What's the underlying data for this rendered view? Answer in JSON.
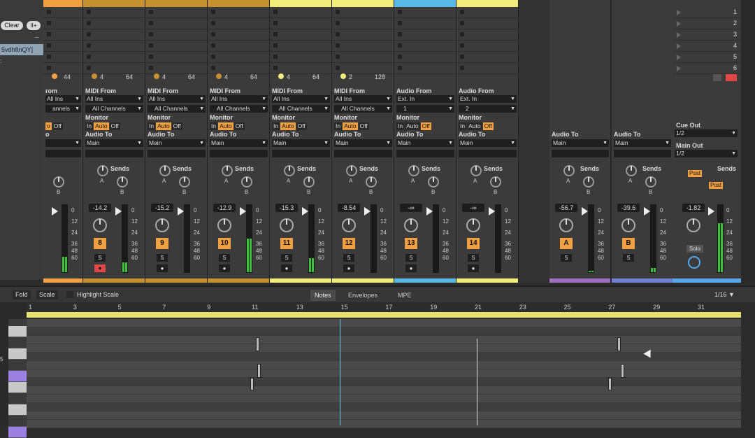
{
  "left": {
    "clear_label": "Clear",
    "more_label": "II+",
    "clip_id": "5vdh8nQY]",
    "minus": "–",
    "dot": ":"
  },
  "tracks": [
    {
      "sub": "4",
      "stop_count": "4",
      "from_label": "rom",
      "from_value": "All Ins",
      "ch": "annels",
      "mon": [
        "o",
        "Off"
      ],
      "mon_on": 0,
      "audio_to": "o",
      "audio_to_val": "",
      "vol": "",
      "num": "",
      "solo": "",
      "arm": "",
      "color": "#f0a040",
      "sends": "",
      "knob_a": "",
      "knob_b": "B",
      "scale": [
        "0",
        "12",
        "24",
        "36",
        "48",
        "60"
      ]
    },
    {
      "sub": "4",
      "stop_count": "64",
      "from_label": "MIDI From",
      "from_value": "All Ins",
      "ch": "All Channels",
      "mon": [
        "In",
        "Auto",
        "Off"
      ],
      "mon_on": 1,
      "audio_to": "Audio To",
      "audio_to_val": "Main",
      "vol": "-14.2",
      "num": "8",
      "solo": "S",
      "arm": "⏺",
      "armred": true,
      "color": "#c49030",
      "sends": "Sends",
      "knob_a": "A",
      "knob_b": "B",
      "scale": [
        "0",
        "12",
        "24",
        "36",
        "48",
        "60"
      ]
    },
    {
      "sub": "4",
      "stop_count": "64",
      "from_label": "MIDI From",
      "from_value": "All Ins",
      "ch": "All Channels",
      "mon": [
        "In",
        "Auto",
        "Off"
      ],
      "mon_on": 1,
      "audio_to": "Audio To",
      "audio_to_val": "Main",
      "vol": "-15.2",
      "num": "9",
      "solo": "S",
      "arm": "●",
      "armred": false,
      "color": "#c49030",
      "sends": "Sends",
      "knob_a": "A",
      "knob_b": "B",
      "scale": [
        "0",
        "12",
        "24",
        "36",
        "48",
        "60"
      ]
    },
    {
      "sub": "4",
      "stop_count": "64",
      "from_label": "MIDI From",
      "from_value": "All Ins",
      "ch": "All Channels",
      "mon": [
        "In",
        "Auto",
        "Off"
      ],
      "mon_on": 1,
      "audio_to": "Audio To",
      "audio_to_val": "Main",
      "vol": "-12.9",
      "num": "10",
      "solo": "S",
      "arm": "●",
      "armred": false,
      "color": "#c49030",
      "sends": "Sends",
      "knob_a": "A",
      "knob_b": "B",
      "scale": [
        "0",
        "12",
        "24",
        "36",
        "48",
        "60"
      ]
    },
    {
      "sub": "4",
      "stop_count": "64",
      "from_label": "MIDI From",
      "from_value": "All Ins",
      "ch": "All Channels",
      "mon": [
        "In",
        "Auto",
        "Off"
      ],
      "mon_on": 1,
      "audio_to": "Audio To",
      "audio_to_val": "Main",
      "vol": "-15.3",
      "num": "11",
      "solo": "S",
      "arm": "●",
      "armred": false,
      "color": "#f2ec7a",
      "sends": "Sends",
      "knob_a": "A",
      "knob_b": "B",
      "scale": [
        "0",
        "12",
        "24",
        "36",
        "48",
        "60"
      ]
    },
    {
      "sub": "2",
      "stop_count": "128",
      "from_label": "MIDI From",
      "from_value": "All Ins",
      "ch": "All Channels",
      "mon": [
        "In",
        "Auto",
        "Off"
      ],
      "mon_on": 1,
      "audio_to": "Audio To",
      "audio_to_val": "Main",
      "vol": "-8.54",
      "num": "12",
      "solo": "S",
      "arm": "●",
      "armred": false,
      "color": "#f2ec7a",
      "sends": "Sends",
      "knob_a": "A",
      "knob_b": "B",
      "scale": [
        "0",
        "12",
        "24",
        "36",
        "48",
        "60"
      ]
    },
    {
      "sub": "",
      "stop_count": "",
      "from_label": "Audio From",
      "from_value": "Ext. In",
      "ch": "1",
      "mon": [
        "In",
        "Auto",
        "Off"
      ],
      "mon_on": 2,
      "audio_to": "Audio To",
      "audio_to_val": "Main",
      "vol": "-∞",
      "num": "13",
      "solo": "S",
      "arm": "●",
      "armred": false,
      "color": "#58b8e8",
      "sends": "Sends",
      "knob_a": "A",
      "knob_b": "B",
      "scale": [
        "0",
        "12",
        "24",
        "36",
        "48",
        "60"
      ]
    },
    {
      "sub": "",
      "stop_count": "",
      "from_label": "Audio From",
      "from_value": "Ext. In",
      "ch": "2",
      "mon": [
        "In",
        "Auto",
        "Off"
      ],
      "mon_on": 2,
      "audio_to": "Audio To",
      "audio_to_val": "Main",
      "vol": "-∞",
      "num": "14",
      "solo": "S",
      "arm": "●",
      "armred": false,
      "color": "#f2ec7a",
      "sends": "Sends",
      "knob_a": "A",
      "knob_b": "B",
      "scale": [
        "0",
        "12",
        "24",
        "36",
        "48",
        "60"
      ]
    }
  ],
  "returns": [
    {
      "audio_to": "Audio To",
      "audio_to_val": "Main",
      "vol": "-56.7",
      "num": "A",
      "solo": "S",
      "sends": "Sends",
      "knob_a": "A",
      "knob_b": "B",
      "scale": [
        "0",
        "12",
        "24",
        "36",
        "48",
        "60"
      ],
      "color": "#a070c0"
    },
    {
      "audio_to": "Audio To",
      "audio_to_val": "Main",
      "vol": "-39.6",
      "num": "B",
      "solo": "S",
      "sends": "Sends",
      "knob_a": "A",
      "knob_b": "B",
      "scale": [
        "0",
        "12",
        "24",
        "36",
        "48",
        "60"
      ],
      "color": "#7080d0"
    }
  ],
  "master": {
    "cue_label": "Cue Out",
    "cue_val": "1/2",
    "main_label": "Main Out",
    "main_val": "1/2",
    "sends": "Sends",
    "post1": "Post",
    "post2": "Post",
    "vol": "-1.82",
    "solo": "Solo",
    "scale": [
      "0",
      "12",
      "24",
      "36",
      "48",
      "60"
    ],
    "color": "#58a8e8"
  },
  "scenes": [
    "1",
    "2",
    "3",
    "4",
    "5",
    "6"
  ],
  "clip": {
    "fold": "Fold",
    "scale": "Scale",
    "highlight": "Highlight Scale",
    "tabs": [
      "Notes",
      "Envelopes",
      "MPE"
    ],
    "active_tab": 0,
    "grid": "1/16",
    "ruler": [
      "1",
      "3",
      "5",
      "7",
      "9",
      "11",
      "13",
      "15",
      "17",
      "19",
      "21",
      "23",
      "25",
      "27",
      "29",
      "31"
    ],
    "side_num": "5"
  },
  "colors": {
    "orange": "#f0a040",
    "yellow": "#f2ec7a",
    "meter": "#3ec23e"
  }
}
